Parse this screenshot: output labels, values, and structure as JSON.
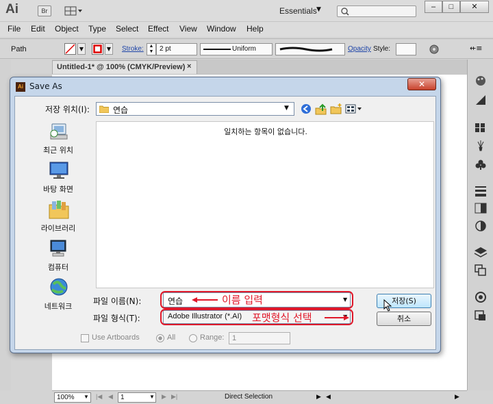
{
  "app": {
    "logo": "Ai",
    "bridge": "Br",
    "workspace": "Essentials",
    "search_placeholder": "",
    "window_controls": [
      "–",
      "□",
      "✕"
    ]
  },
  "menu": [
    "File",
    "Edit",
    "Object",
    "Type",
    "Select",
    "Effect",
    "View",
    "Window",
    "Help"
  ],
  "control_bar": {
    "selection_type": "Path",
    "stroke_label": "Stroke:",
    "stroke_weight": "2 pt",
    "profile": "Uniform",
    "opacity_label": "Opacity",
    "style_label": "Style:"
  },
  "document_tab": {
    "title": "Untitled-1* @ 100% (CMYK/Preview)",
    "close": "×"
  },
  "status_bar": {
    "zoom": "100%",
    "page": "1",
    "tool": "Direct Selection"
  },
  "dialog": {
    "title": "Save As",
    "lookin_label": "저장 위치(I):",
    "lookin_value": "연습",
    "places": [
      {
        "label": "최근 위치",
        "icon": "recent-places-icon"
      },
      {
        "label": "바탕 화면",
        "icon": "desktop-icon"
      },
      {
        "label": "라이브러리",
        "icon": "libraries-icon"
      },
      {
        "label": "컴퓨터",
        "icon": "computer-icon"
      },
      {
        "label": "네트워크",
        "icon": "network-icon"
      }
    ],
    "empty_message": "일치하는 항목이 없습니다.",
    "filename_label": "파일 이름(N):",
    "filename_value": "연습",
    "filetype_label": "파일 형식(T):",
    "filetype_value": "Adobe Illustrator (*.AI)",
    "save_button": "저장(S)",
    "cancel_button": "취소",
    "use_artboards": "Use Artboards",
    "all": "All",
    "range": "Range:",
    "range_value": "1"
  },
  "annotations": {
    "filename_hint": "이름 입력",
    "filetype_hint": "포맷형식 선택"
  },
  "colors": {
    "annotation": "#e0182a",
    "dialog_frame": "#c5d6ea",
    "link": "#1d44a8"
  }
}
